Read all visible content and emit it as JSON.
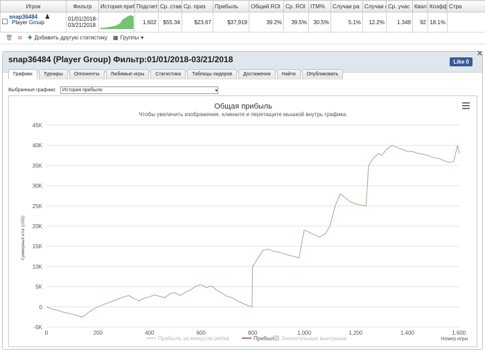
{
  "table": {
    "headers": [
      "Игрок",
      "Фильтр",
      "История приб",
      "Подсчет",
      "Ср. став",
      "Ср. приз",
      "Прибыль",
      "Общий ROI",
      "Ср. ROI",
      "ITM%",
      "Случаи ра",
      "Случаи о",
      "Ср. учас",
      "Квал",
      "Коэфф",
      "Стра"
    ],
    "player_name": "snap36484",
    "player_group": "Player Group",
    "filter_from": "01/01/2018-",
    "filter_to": "03/21/2018",
    "cells": [
      "1,602",
      "$55.34",
      "$23.67",
      "$37,919",
      "39.2%",
      "39.5%",
      "30.5%",
      "5.1%",
      "12.2%",
      "1.349",
      "92",
      "18.1%",
      ""
    ]
  },
  "toolbar": {
    "add_stats": "Добавить другую статистику",
    "groups": "Группы"
  },
  "panel": {
    "title": "snap36484 (Player Group) Фильтр:01/01/2018-03/21/2018",
    "like": "Like 0",
    "tabs": [
      "Графики",
      "Турниры",
      "Оппоненты",
      "Любимые игры",
      "Статистика",
      "Таблицы лидеров",
      "Достижения",
      "Найти",
      "Опубликовать"
    ],
    "selector_label": "Выбранные графики:",
    "selector_value": "История прибыли"
  },
  "chart_data": {
    "type": "line",
    "title": "Общая прибыль",
    "subtitle": "Чтобы увеличить изображение, кликните и перетащите мышкой внутрь графика.",
    "ylabel": "Суммарный итог (USD)",
    "xlabel": "Номер игры",
    "xlim": [
      0,
      1602
    ],
    "ylim": [
      -5000,
      45000
    ],
    "x_ticks": [
      "0",
      "200",
      "400",
      "600",
      "800",
      "1,000",
      "1,200",
      "1,400",
      "1,600"
    ],
    "y_ticks": [
      "-5K",
      "0",
      "5K",
      "10K",
      "15K",
      "20K",
      "25K",
      "30K",
      "35K",
      "40K",
      "45K"
    ],
    "legend": [
      "Прибыль за минусом рейка",
      "Прибыль",
      "Значительные выигрыши"
    ],
    "series": [
      {
        "name": "Прибыль",
        "x": [
          0,
          20,
          40,
          60,
          80,
          100,
          120,
          140,
          160,
          180,
          200,
          230,
          260,
          280,
          300,
          320,
          340,
          360,
          380,
          400,
          420,
          440,
          460,
          480,
          500,
          520,
          540,
          560,
          580,
          600,
          620,
          640,
          660,
          680,
          700,
          720,
          740,
          760,
          780,
          798,
          800,
          820,
          840,
          860,
          880,
          900,
          920,
          940,
          960,
          980,
          1000,
          1020,
          1040,
          1060,
          1080,
          1100,
          1120,
          1140,
          1160,
          1180,
          1200,
          1220,
          1240,
          1250,
          1270,
          1290,
          1300,
          1320,
          1340,
          1360,
          1380,
          1400,
          1420,
          1440,
          1460,
          1480,
          1500,
          1520,
          1540,
          1560,
          1580,
          1595,
          1602
        ],
        "y": [
          0,
          -500,
          -800,
          -1200,
          -1500,
          -1800,
          -2200,
          -2500,
          -1500,
          -600,
          0,
          800,
          1500,
          2000,
          2500,
          2800,
          2000,
          1500,
          2200,
          2500,
          3000,
          2600,
          2300,
          3300,
          3500,
          2800,
          3700,
          4200,
          5200,
          5500,
          4800,
          5200,
          4200,
          3500,
          2600,
          2300,
          1500,
          900,
          400,
          0,
          10000,
          12000,
          14000,
          14300,
          13800,
          13600,
          13200,
          12800,
          12500,
          12200,
          19000,
          18500,
          17800,
          17300,
          18000,
          20000,
          25000,
          28000,
          27000,
          26000,
          25500,
          25200,
          25000,
          35000,
          37000,
          38000,
          37500,
          39000,
          40000,
          39500,
          39000,
          38500,
          38500,
          38000,
          37800,
          37500,
          37000,
          36800,
          36300,
          35800,
          36000,
          40000,
          38000
        ]
      }
    ]
  }
}
